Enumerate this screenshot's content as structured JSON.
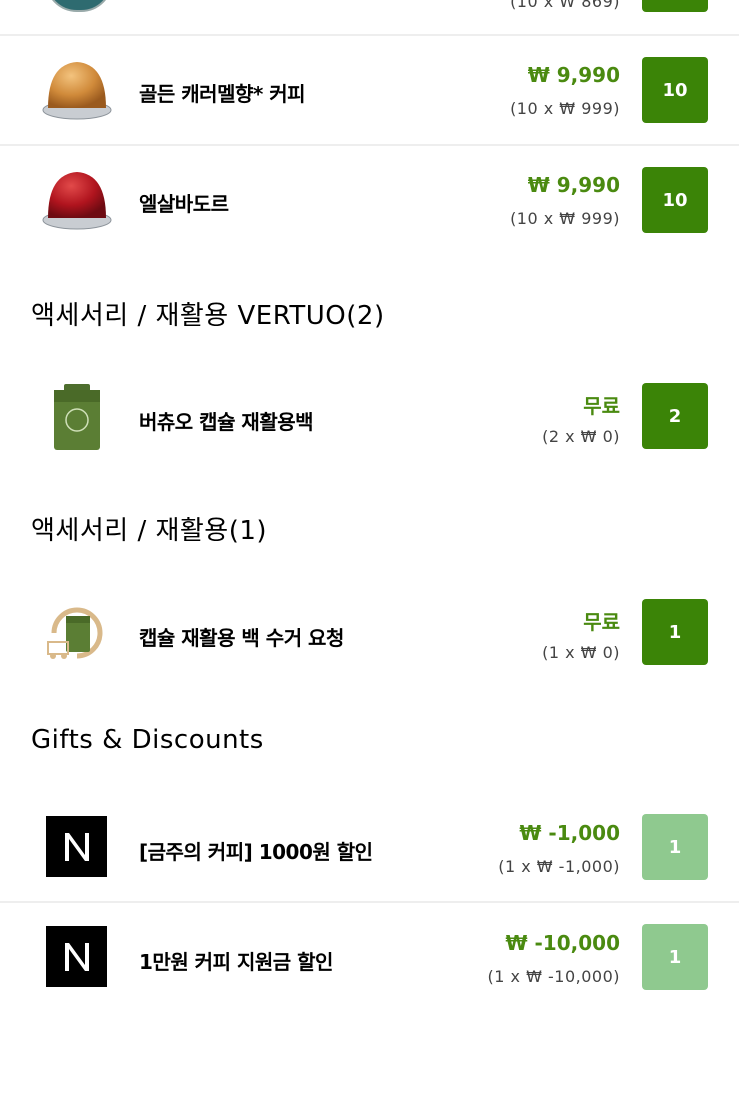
{
  "top_row": {
    "unit": "(10 x ₩ 869)"
  },
  "items": [
    {
      "name": "골든 캐러멜향* 커피",
      "price": "₩ 9,990",
      "unit": "(10 x ₩ 999)",
      "qty": "10"
    },
    {
      "name": "엘살바도르",
      "price": "₩ 9,990",
      "unit": "(10 x ₩ 999)",
      "qty": "10"
    }
  ],
  "sections": [
    {
      "title": "액세서리 / 재활용 VERTUO(2)",
      "items": [
        {
          "name": "버츄오 캡슐 재활용백",
          "price": "무료",
          "unit": "(2 x ₩ 0)",
          "qty": "2"
        }
      ]
    },
    {
      "title": "액세서리 / 재활용(1)",
      "items": [
        {
          "name": "캡슐 재활용 백 수거 요청",
          "price": "무료",
          "unit": "(1 x ₩ 0)",
          "qty": "1"
        }
      ]
    },
    {
      "title": "Gifts & Discounts",
      "items": [
        {
          "name": "[금주의 커피] 1000원 할인",
          "price": "₩ -1,000",
          "unit": "(1 x ₩ -1,000)",
          "qty": "1"
        },
        {
          "name": "1만원 커피 지원금 할인",
          "price": "₩ -10,000",
          "unit": "(1 x ₩ -10,000)",
          "qty": "1"
        }
      ]
    }
  ],
  "colors": {
    "accent": "#3b8407",
    "accent_disabled": "#8fc98f",
    "price": "#4a8a10"
  }
}
